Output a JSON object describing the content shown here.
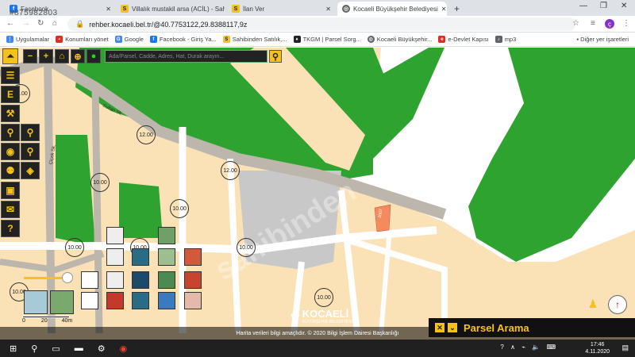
{
  "browser": {
    "watermark_id": "#875982803",
    "tabs": [
      {
        "title": "Facebook",
        "favicon": "facebook-icon"
      },
      {
        "title": "Villalık mustakil arsa (ACİL) - Sah",
        "favicon": "sahibinden-icon"
      },
      {
        "title": "İlan Ver",
        "favicon": "sahibinden-icon"
      },
      {
        "title": "Kocaeli Büyükşehir Belediyesi",
        "favicon": "globe-icon"
      }
    ],
    "new_tab": "+",
    "url": "rehber.kocaeli.bel.tr/@40.7753122,29.8388117,9z",
    "profile_initial": "ç",
    "bookmarks": [
      {
        "label": "Uygulamalar",
        "icon": "apps-icon",
        "color": "#4285f4"
      },
      {
        "label": "Konumları yönet",
        "icon": "folder-icon",
        "color": "#d93025"
      },
      {
        "label": "Google",
        "icon": "google-icon",
        "color": "#4285f4"
      },
      {
        "label": "Facebook - Giriş Ya...",
        "icon": "facebook-icon",
        "color": "#1877f2"
      },
      {
        "label": "Sahibinden Satılık,...",
        "icon": "sahibinden-icon",
        "color": "#f4c21a"
      },
      {
        "label": "TKGM | Parsel Sorg...",
        "icon": "pin-icon",
        "color": "#222222"
      },
      {
        "label": "Kocaeli Büyükşehir...",
        "icon": "globe-icon",
        "color": "#5f6368"
      },
      {
        "label": "e-Devlet Kapısı",
        "icon": "edevlet-icon",
        "color": "#d93025"
      },
      {
        "label": "mp3",
        "icon": "music-icon",
        "color": "#5f6368"
      }
    ],
    "other_bookmarks": "Diğer yer işaretleri"
  },
  "map": {
    "search_placeholder": "Ada/Parsel, Cadde, Adres, Hat, Durak arayın...",
    "road_labels": [
      "12.00",
      "12.00",
      "10.00",
      "10.00",
      "10.00",
      "10.00",
      "10.00",
      "10.00",
      "10.00",
      "10.00",
      "10.00"
    ],
    "street_names": [
      "Sultan Sk.",
      "Çiçek Sk."
    ],
    "parcel_badge": "2007",
    "footer_text": "Harita verileri bilgi amaçlıdır. © 2020 Bilgi İşlem Dairesi Başkanlığı",
    "logo_text": "KOCAELİ",
    "logo_sub": "BÜYÜKŞEHİR BELEDİYESİ",
    "scale_labels": [
      "0",
      "20",
      "40m"
    ],
    "watermark": "sahibinden",
    "panel_title": "Parsel Arama",
    "colors": {
      "park": "#2fa32f",
      "parcel": "#fbe2b6",
      "road": "#c8c8c8",
      "accent": "#f4c21a"
    }
  },
  "taskbar": {
    "time": "17:46",
    "date": "4.11.2020"
  }
}
